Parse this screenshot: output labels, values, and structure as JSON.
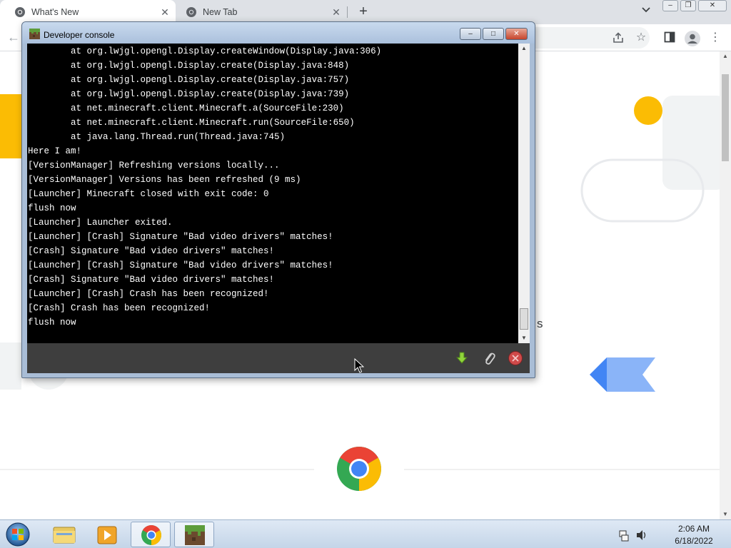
{
  "browser": {
    "tabs": [
      {
        "label": "What's New",
        "active": true
      },
      {
        "label": "New Tab",
        "active": false
      }
    ],
    "new_tab_glyph": "+",
    "close_glyph": "✕",
    "window_controls": [
      "minimize",
      "restore",
      "close"
    ],
    "toolbar_icons": [
      "share-icon",
      "star-icon",
      "side-panel-icon",
      "profile-icon",
      "menu-icon"
    ],
    "page_partial_text": "s"
  },
  "console": {
    "title": "Developer console",
    "lines": [
      "\tat org.lwjgl.opengl.Display.createWindow(Display.java:306)",
      "\tat org.lwjgl.opengl.Display.create(Display.java:848)",
      "\tat org.lwjgl.opengl.Display.create(Display.java:757)",
      "\tat org.lwjgl.opengl.Display.create(Display.java:739)",
      "\tat net.minecraft.client.Minecraft.a(SourceFile:230)",
      "\tat net.minecraft.client.Minecraft.run(SourceFile:650)",
      "\tat java.lang.Thread.run(Thread.java:745)",
      "Here I am!",
      "[VersionManager] Refreshing versions locally...",
      "[VersionManager] Versions has been refreshed (9 ms)",
      "[Launcher] Minecraft closed with exit code: 0",
      "flush now",
      "[Launcher] Launcher exited.",
      "[Launcher] [Crash] Signature \"Bad video drivers\" matches!",
      "[Crash] Signature \"Bad video drivers\" matches!",
      "[Launcher] [Crash] Signature \"Bad video drivers\" matches!",
      "[Crash] Signature \"Bad video drivers\" matches!",
      "[Launcher] [Crash] Crash has been recognized!",
      "[Crash] Crash has been recognized!",
      "flush now"
    ],
    "bottom_actions": [
      "download-icon",
      "attach-icon",
      "close-circle-icon"
    ]
  },
  "taskbar": {
    "pinned": [
      "windows-explorer-icon",
      "media-player-icon",
      "chrome-icon",
      "minecraft-launcher-icon"
    ],
    "clock": {
      "time": "2:06 AM",
      "date": "6/18/2022"
    }
  },
  "colors": {
    "console_bg": "#000000",
    "console_text": "#ffffff",
    "titlebar": "#b4c8e1",
    "taskbar": "#d2dfee",
    "chrome_yellow": "#fbbc04",
    "chrome_blue": "#4285f4"
  }
}
